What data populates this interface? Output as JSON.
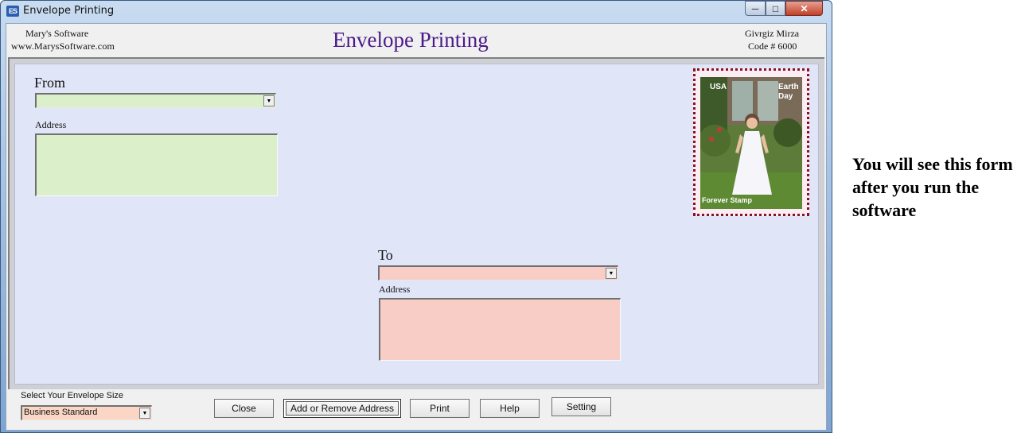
{
  "window": {
    "title": "Envelope Printing",
    "icon": "envelope-app-icon",
    "controls": {
      "minimize": "minimize-icon",
      "maximize": "maximize-icon",
      "close": "close-icon"
    }
  },
  "header": {
    "company_name": "Mary's Software",
    "company_url": "www.MarysSoftware.com",
    "title": "Envelope Printing",
    "user_name": "Givrgiz Mirza",
    "user_code": "Code # 6000"
  },
  "from": {
    "label": "From",
    "selected": "",
    "address_label": "Address",
    "address_value": ""
  },
  "to": {
    "label": "To",
    "selected": "",
    "address_label": "Address",
    "address_value": ""
  },
  "stamp": {
    "left_text": "USA",
    "right_text": "Earth Day",
    "bottom_text": "Forever Stamp"
  },
  "footer": {
    "size_label": "Select Your Envelope Size",
    "size_value": "Business Standard",
    "buttons": {
      "close": "Close",
      "add_remove": "Add or Remove Address",
      "print": "Print",
      "help": "Help",
      "setting": "Setting"
    }
  },
  "side_note": "You will see this form after you run the software",
  "colors": {
    "title_purple": "#4b1a8a",
    "from_fill": "#dcefcb",
    "to_fill": "#f7cdc6",
    "envelope_fill": "#e1e5f8",
    "stamp_border": "#8a0f2a",
    "size_fill": "#fbd6c4"
  }
}
